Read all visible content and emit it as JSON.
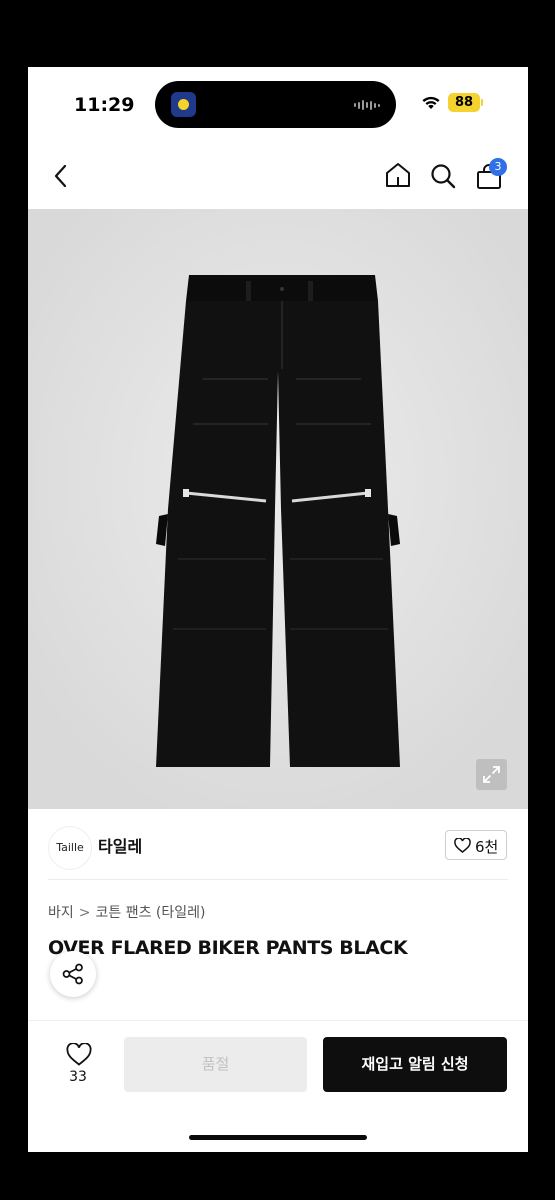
{
  "status_bar": {
    "time": "11:29",
    "battery": "88",
    "battery_color": "#f4d22f",
    "icons": [
      "wifi-icon",
      "soundwave-icon",
      "live-activity-app-icon"
    ]
  },
  "header": {
    "icons": [
      "back-chevron-icon",
      "home-icon",
      "search-icon",
      "shopping-bag-icon"
    ],
    "cart_badge": "3",
    "badge_color": "#2f6fe8"
  },
  "product": {
    "image_description_icon": "expand-icon"
  },
  "shop": {
    "logo_text": "Taille",
    "name": "타일레",
    "like_count": "6천"
  },
  "breadcrumb": {
    "items": [
      "바지",
      "코튼 팬츠 (타일레)"
    ],
    "separator": ">"
  },
  "title": "OVER FLARED BIKER PANTS BLACK",
  "bottom_bar": {
    "wish_count": "33",
    "soldout_label": "품절",
    "restock_label": "재입고 알림 신청"
  }
}
